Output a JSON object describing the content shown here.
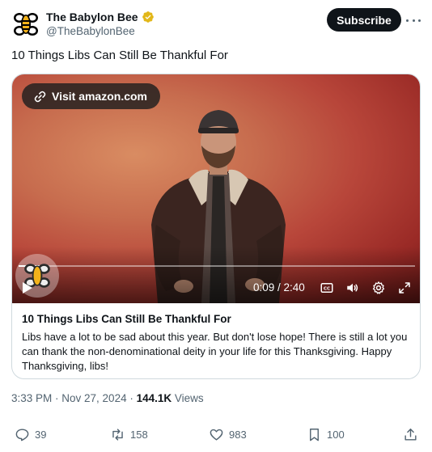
{
  "account": {
    "name": "The Babylon Bee",
    "handle": "@TheBabylonBee",
    "subscribe_label": "Subscribe"
  },
  "tweet": {
    "text": "10 Things Libs Can Still Be Thankful For"
  },
  "media": {
    "visit_label": "Visit amazon.com",
    "time": "0:09 / 2:40",
    "progress": 0.056,
    "controls": [
      "play-icon",
      "closed-captions-icon",
      "volume-icon",
      "settings-icon",
      "fullscreen-icon"
    ]
  },
  "card": {
    "title": "10 Things Libs Can Still Be Thankful For",
    "description": "Libs have a lot to be sad about this year. But don't lose hope! There is still a lot you can thank the non-denominational deity in your life for this Thanksgiving. Happy Thanksgiving, libs!"
  },
  "meta": {
    "timestamp": "3:33 PM · Nov 27, 2024 · ",
    "views_count": "144.1K",
    "views_label": " Views"
  },
  "actions": {
    "replies": "39",
    "reposts": "158",
    "likes": "983",
    "bookmarks": "100"
  },
  "colors": {
    "text": "#0f1419",
    "secondary": "#536471",
    "verified_gold": "#e2b719",
    "border": "#cfd9de"
  }
}
